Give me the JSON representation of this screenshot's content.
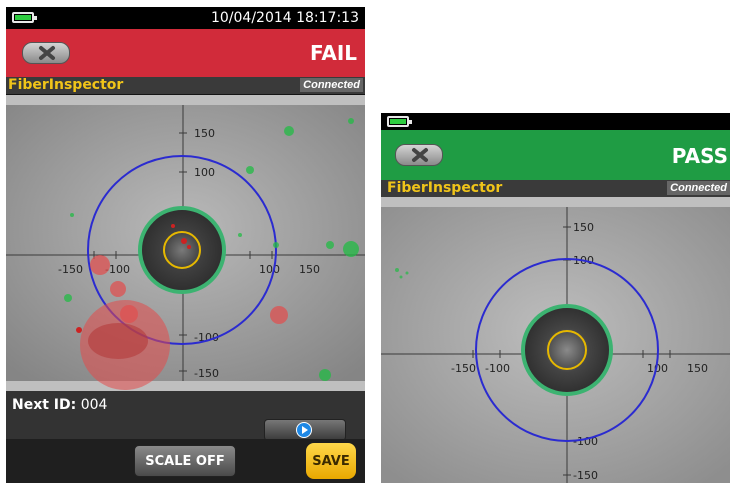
{
  "fail_screen": {
    "datetime": "10/04/2014 18:17:13",
    "result": "FAIL",
    "app_title": "FiberInspector",
    "connection": "Connected",
    "next_id_label": "Next ID:",
    "next_id_value": "004",
    "scale_button": "SCALE OFF",
    "save_button": "SAVE",
    "axis_labels": {
      "up1": "150",
      "up2": "100",
      "down1": "-100",
      "down2": "-150",
      "left1": "-150",
      "left2": "-100",
      "right1": "100",
      "right2": "150"
    }
  },
  "pass_screen": {
    "result": "PASS",
    "app_title": "FiberInspector",
    "connection": "Connected",
    "axis_labels": {
      "up1": "150",
      "up2": "100",
      "down1": "-100",
      "down2": "-150",
      "left1": "-150",
      "left2": "-100",
      "right1": "100",
      "right2": "150"
    }
  },
  "colors": {
    "fail": "#d12b3a",
    "pass": "#1f9c44",
    "title_yellow": "#f0c419",
    "zone_blue": "#2b2bd0",
    "core_yellow": "#e6b800",
    "cladding_green": "#3cb371",
    "defect_red": "#e34b4b"
  },
  "icons": {
    "back": "back-x-icon",
    "battery": "battery-icon",
    "play": "play-icon"
  }
}
